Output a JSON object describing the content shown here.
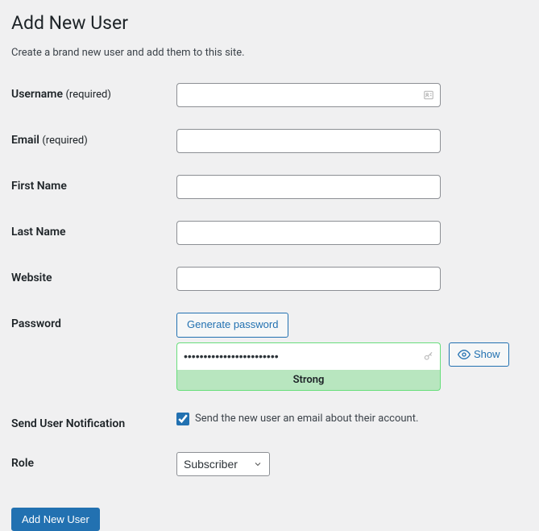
{
  "page": {
    "title": "Add New User",
    "subtitle": "Create a brand new user and add them to this site."
  },
  "form": {
    "username": {
      "label": "Username",
      "required_suffix": "(required)",
      "value": ""
    },
    "email": {
      "label": "Email",
      "required_suffix": "(required)",
      "value": ""
    },
    "first_name": {
      "label": "First Name",
      "value": ""
    },
    "last_name": {
      "label": "Last Name",
      "value": ""
    },
    "website": {
      "label": "Website",
      "value": ""
    },
    "password": {
      "label": "Password",
      "generate_button": "Generate password",
      "value": "••••••••••••••••••••••••",
      "strength": "Strong",
      "show_button": "Show"
    },
    "notification": {
      "label": "Send User Notification",
      "checkbox_label": "Send the new user an email about their account.",
      "checked": true
    },
    "role": {
      "label": "Role",
      "selected": "Subscriber"
    },
    "submit": "Add New User"
  }
}
